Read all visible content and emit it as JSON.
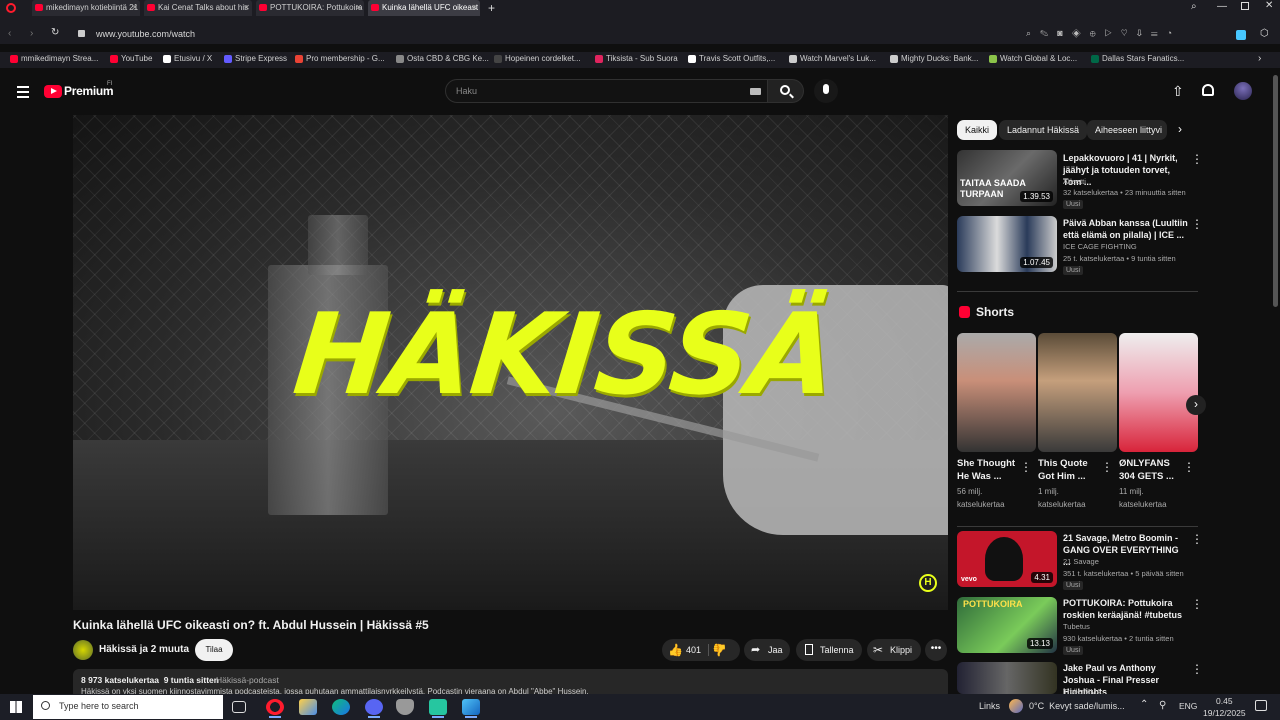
{
  "browser": {
    "tabs": [
      {
        "label": "mikedimayn kotiebiintä 21"
      },
      {
        "label": "Kai Cenat Talks about his"
      },
      {
        "label": "POTTUKOIRA: Pottukoira"
      },
      {
        "label": "Kuinka lähellä UFC oikeast",
        "active": true
      }
    ],
    "url": "www.youtube.com/watch",
    "bookmarks": [
      {
        "label": "mmikedimayn Strea...",
        "color": "#ff0033"
      },
      {
        "label": "YouTube",
        "color": "#ff0033"
      },
      {
        "label": "Etusivu / X",
        "color": "#ffffff"
      },
      {
        "label": "Stripe Express",
        "color": "#635bff"
      },
      {
        "label": "Pro membership - G...",
        "color": "#ea4335"
      },
      {
        "label": "Osta CBD & CBG Ke...",
        "color": "#888888"
      },
      {
        "label": "Hopeinen cordelket...",
        "color": "#444444"
      },
      {
        "label": "Tiksista - Sub Suora",
        "color": "#e0245e"
      },
      {
        "label": "Travis Scott Outfits,...",
        "color": "#ffffff"
      },
      {
        "label": "Watch Marvel's Luk...",
        "color": "#cccccc"
      },
      {
        "label": "Mighty Ducks: Bank...",
        "color": "#cccccc"
      },
      {
        "label": "Watch Global & Loc...",
        "color": "#8bc34a"
      },
      {
        "label": "Dallas Stars Fanatics...",
        "color": "#006847"
      }
    ]
  },
  "header": {
    "logo_text": "Premium",
    "logo_region": "FI",
    "search_placeholder": "Haku"
  },
  "video": {
    "art_text": "HÄKISSÄ",
    "badge": "H",
    "title": "Kuinka lähellä UFC oikeasti on? ft. Abdul Hussein | Häkissä #5",
    "channel": "Häkissä ja 2 muuta",
    "subscribe": "Tilaa",
    "likes": "401",
    "share": "Jaa",
    "save": "Tallenna",
    "clip": "Klippi",
    "views_meta": "8 973 katselukertaa  9 tuntia sitten",
    "podcast_tag": "Häkissä-podcast",
    "description": "Häkissä on yksi suomen kiinnostavimmista podcasteista, jossa puhutaan ammattilaisnyrkkeilystä. Podcastin vieraana on Abdul \"Abbe\" Hussein."
  },
  "sidebar": {
    "chips": [
      {
        "label": "Kaikki",
        "active": true
      },
      {
        "label": "Ladannut Häkissä"
      },
      {
        "label": "Aiheeseen liittyvi"
      }
    ],
    "top_videos": [
      {
        "title": "Lepakkovuoro | 41 | Nyrkit, jäähyt ja totuuden torvet, Tom ...",
        "channel": "Atleetti",
        "meta": "32 katselukertaa • 23 minuuttia sitten",
        "badge": "Uusi",
        "duration": "1.39.53",
        "thumb_text": "TAITAA SAADA TURPAAN"
      },
      {
        "title": "Päivä Abban kanssa (Luultiin että elämä on pilalla) | ICE ...",
        "channel": "ICE CAGE FIGHTING",
        "meta": "25 t. katselukertaa • 9 tuntia sitten",
        "badge": "Uusi",
        "duration": "1.07.45"
      }
    ],
    "shorts_heading": "Shorts",
    "shorts": [
      {
        "title": "She Thought He Was ...",
        "views": "56 milj. katselukertaa"
      },
      {
        "title": "This Quote Got Him ...",
        "views": "1 milj. katselukertaa"
      },
      {
        "title": "ØNLYFANS 304 GETS ...",
        "views": "11 milj. katselukertaa"
      }
    ],
    "bottom_videos": [
      {
        "title": "21 Savage, Metro Boomin - GANG OVER EVERYTHING ...",
        "channel": "21 Savage",
        "meta": "351 t. katselukertaa • 5 päivää sitten",
        "badge": "Uusi",
        "duration": "4.31",
        "label_text": "vevo"
      },
      {
        "title": "POTTUKOIRA: Pottukoira roskien keräajänä! #tubetus",
        "channel": "Tubetus",
        "meta": "930 katselukertaa • 2 tuntia sitten",
        "badge": "Uusi",
        "duration": "13.13",
        "thumb_text": "POTTUKOIRA"
      },
      {
        "title": "Jake Paul vs Anthony Joshua - Final Presser Highlights",
        "channel": "TrollerMMA"
      }
    ]
  },
  "taskbar": {
    "search_placeholder": "Type here to search",
    "links": "Links",
    "weather": "0°C  Kevyt sade/lumis...",
    "lang": "ENG",
    "time": "0.45",
    "date": "19/12/2025"
  }
}
